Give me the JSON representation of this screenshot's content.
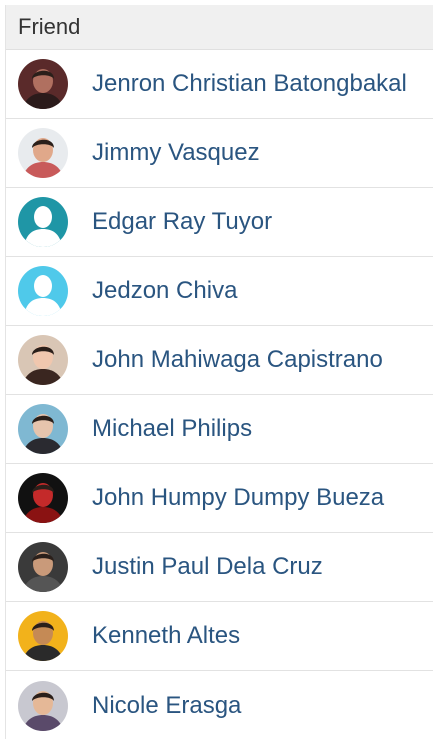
{
  "header": {
    "title": "Friend"
  },
  "friends": [
    {
      "name": "Jenron Christian Batongbakal",
      "avatar": "user-photo",
      "bg": "#5a2a2a",
      "skin": "#b07060",
      "shirt": "#2b1b1b"
    },
    {
      "name": "Jimmy Vasquez",
      "avatar": "user-photo",
      "bg": "#e8ebee",
      "skin": "#e0a88a",
      "shirt": "#c85a5a"
    },
    {
      "name": "Edgar Ray Tuyor",
      "avatar": "default-avatar-icon",
      "bg": "#1f96a6",
      "skin": "#ffffff",
      "shirt": "#ffffff"
    },
    {
      "name": "Jedzon Chiva",
      "avatar": "default-avatar-icon",
      "bg": "#4fc9ea",
      "skin": "#ffffff",
      "shirt": "#ffffff"
    },
    {
      "name": "John Mahiwaga Capistrano",
      "avatar": "user-photo",
      "bg": "#d9c6b5",
      "skin": "#f0c7ae",
      "shirt": "#3a2620"
    },
    {
      "name": "Michael Philips",
      "avatar": "user-photo",
      "bg": "#7fb8d2",
      "skin": "#e6c4ad",
      "shirt": "#2a2a30"
    },
    {
      "name": "John Humpy Dumpy Bueza",
      "avatar": "user-photo",
      "bg": "#111111",
      "skin": "#c42a2a",
      "shirt": "#8a1212"
    },
    {
      "name": "Justin Paul Dela Cruz",
      "avatar": "user-photo",
      "bg": "#3a3a3a",
      "skin": "#c99a7a",
      "shirt": "#555555"
    },
    {
      "name": "Kenneth Altes",
      "avatar": "cartoon-avatar",
      "bg": "#f2b21b",
      "skin": "#c58a55",
      "shirt": "#2a2a2a"
    },
    {
      "name": "Nicole Erasga",
      "avatar": "user-photo",
      "bg": "#c8c8d0",
      "skin": "#e5b897",
      "shirt": "#5a4a6a"
    }
  ]
}
